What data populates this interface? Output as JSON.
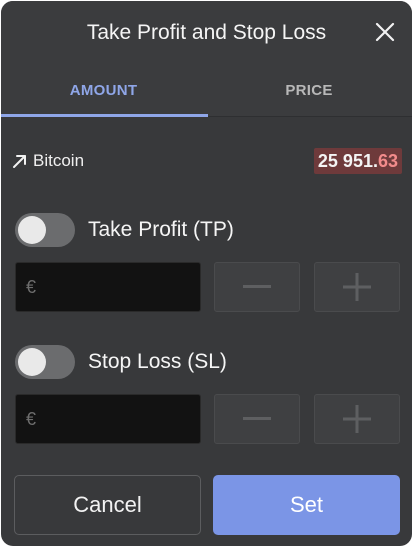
{
  "dialog": {
    "title": "Take Profit and Stop Loss",
    "close_icon": "close-icon"
  },
  "tabs": [
    {
      "label": "AMOUNT",
      "active": true
    },
    {
      "label": "PRICE",
      "active": false
    }
  ],
  "instrument": {
    "name": "Bitcoin",
    "trend_icon": "arrow-up-right-icon",
    "price_main": "25 951.",
    "price_decimals": "63",
    "price_bg_color": "#6e3a3b",
    "price_decimals_color": "#f28b8b"
  },
  "take_profit": {
    "label": "Take Profit (TP)",
    "enabled": false,
    "currency_symbol": "€",
    "value": ""
  },
  "stop_loss": {
    "label": "Stop Loss (SL)",
    "enabled": false,
    "currency_symbol": "€",
    "value": ""
  },
  "footer": {
    "cancel_label": "Cancel",
    "set_label": "Set"
  },
  "colors": {
    "accent": "#8fa6e8",
    "primary_button": "#7b95e6",
    "background": "#38393b"
  }
}
